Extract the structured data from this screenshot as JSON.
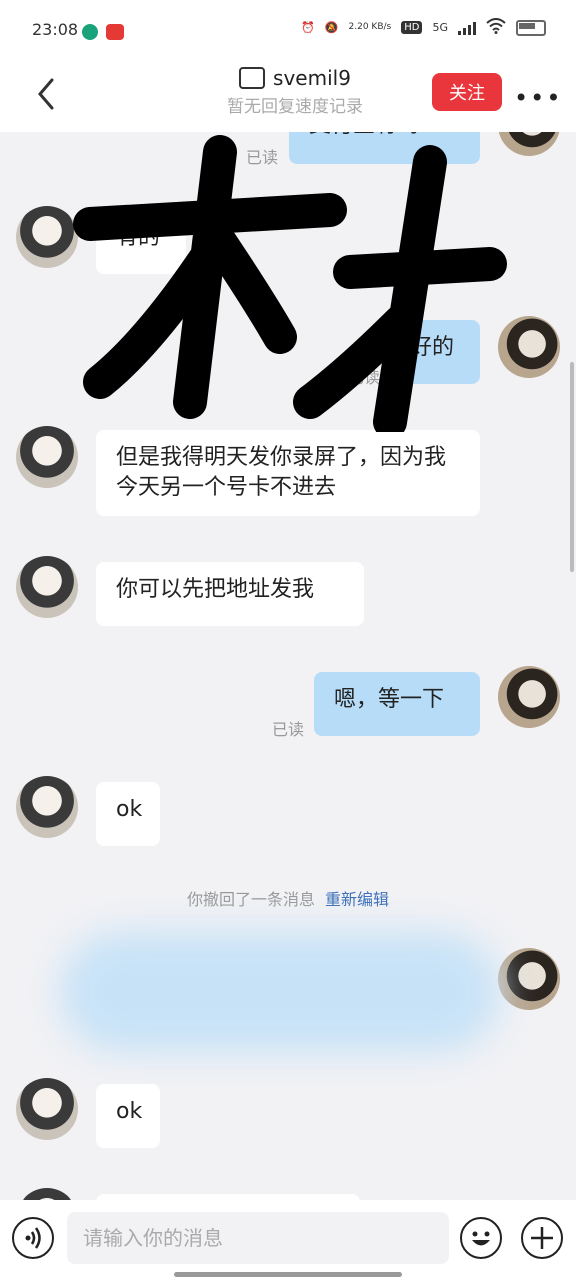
{
  "status_bar": {
    "time": "23:08",
    "net_speed": "2.20\nKB/s",
    "hd": "HD",
    "net_type": "5G"
  },
  "header": {
    "title": "svemil9",
    "subtitle": "暂无回复速度记录",
    "follow_label": "关注",
    "more_label": "•••"
  },
  "messages": [
    {
      "side": "out",
      "text": "支付宝有吗？",
      "read": "已读"
    },
    {
      "side": "in",
      "text": "有的"
    },
    {
      "side": "out",
      "text": "好的",
      "read": "已读"
    },
    {
      "side": "in",
      "text": "但是我得明天发你录屏了，因为我今天另一个号卡不进去"
    },
    {
      "side": "in",
      "text": "你可以先把地址发我"
    },
    {
      "side": "out",
      "text": "嗯，等一下",
      "read": "已读"
    },
    {
      "side": "in",
      "text": "ok"
    },
    {
      "side": "in",
      "text": "ok"
    }
  ],
  "system": {
    "recalled": "你撤回了一条消息",
    "reedit": "重新编辑"
  },
  "input": {
    "placeholder": "请输入你的消息"
  },
  "colors": {
    "follow_button": "#e8363c",
    "outgoing_bubble": "#b7dcf8",
    "incoming_bubble": "#ffffff",
    "link": "#3d6fb8"
  },
  "icons": [
    "back-arrow-icon",
    "cat-badge-icon",
    "more-icon",
    "voice-icon",
    "emoji-icon",
    "plus-icon",
    "alarm-icon",
    "mute-icon",
    "wifi-icon",
    "battery-icon"
  ]
}
